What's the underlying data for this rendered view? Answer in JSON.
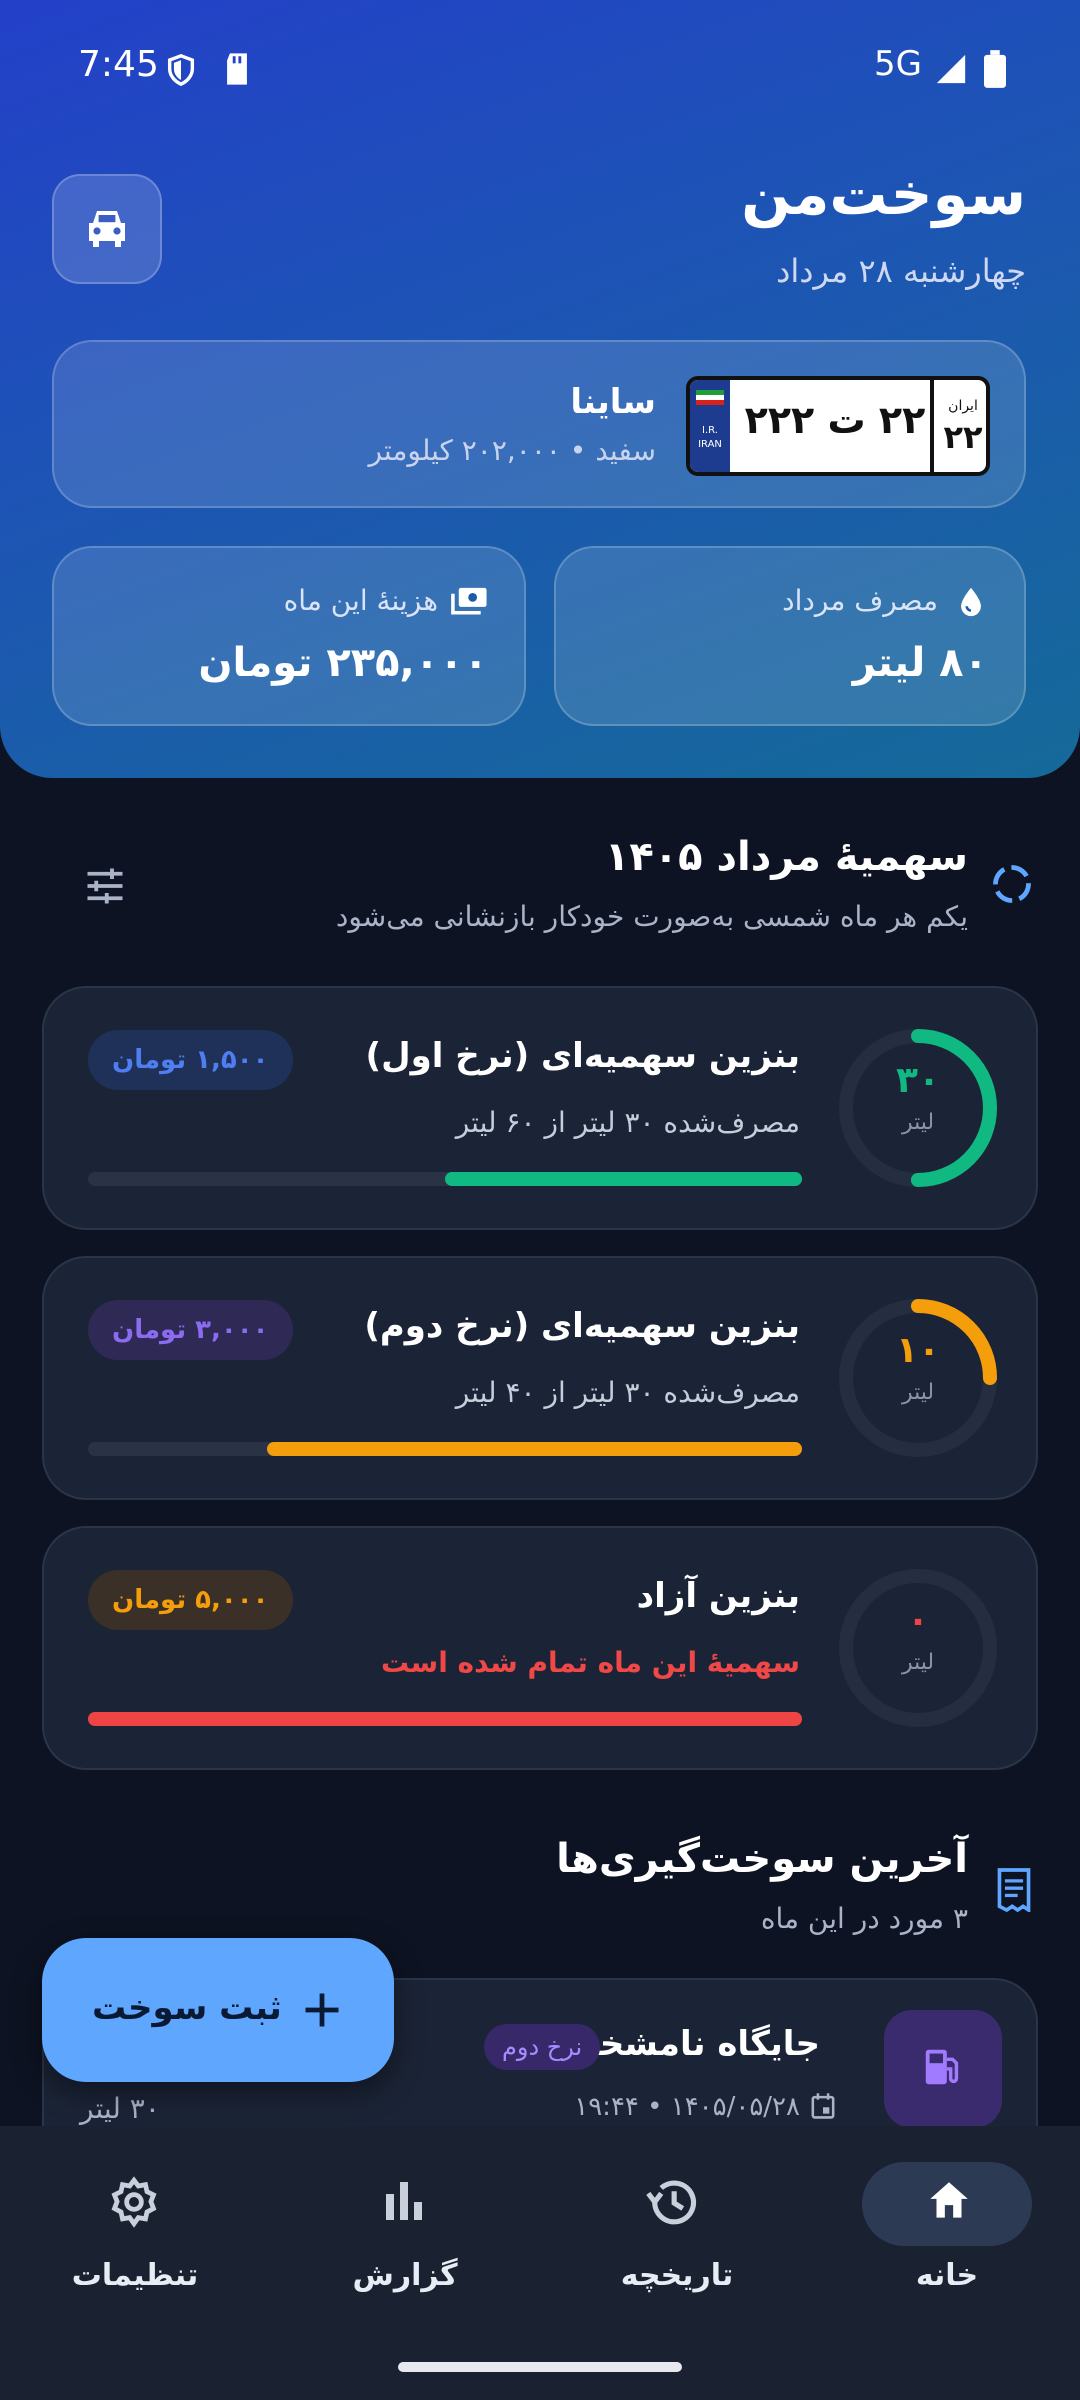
{
  "status_bar": {
    "time": "7:45",
    "network": "5G"
  },
  "header": {
    "app_title": "سوخت‌من",
    "date": "چهارشنبه ۲۸ مرداد"
  },
  "vehicle": {
    "name": "ساینا",
    "details": "سفید • ۲۰۲,۰۰۰ کیلومتر",
    "plate": {
      "number": "۲۲ ت ۲۲۲",
      "region_label": "ایران",
      "region_number": "۲۲",
      "country_text_1": "I.R.",
      "country_text_2": "IRAN"
    }
  },
  "stats": {
    "consumption_label": "مصرف مرداد",
    "consumption_value": "۸۰ لیتر",
    "cost_label": "هزینهٔ این ماه",
    "cost_value": "۲۳۵,۰۰۰ تومان"
  },
  "quota": {
    "title": "سهمیهٔ مرداد ۱۴۰۵",
    "subtitle": "یکم هر ماه شمسی به‌صورت خودکار بازنشانی می‌شود",
    "cards": [
      {
        "name": "بنزین سهمیه‌ای (نرخ اول)",
        "usage": "مصرف‌شده ۳۰ لیتر از ۶۰ لیتر",
        "remaining": "۳۰",
        "unit": "لیتر",
        "price": "۱,۵۰۰ تومان",
        "used_fraction": 0.5,
        "remaining_fraction": 0.5,
        "color": "#10b981",
        "badge_bg": "#1f3158",
        "badge_fg": "#4f7df2"
      },
      {
        "name": "بنزین سهمیه‌ای (نرخ دوم)",
        "usage": "مصرف‌شده ۳۰ لیتر از ۴۰ لیتر",
        "remaining": "۱۰",
        "unit": "لیتر",
        "price": "۳,۰۰۰ تومان",
        "used_fraction": 0.75,
        "remaining_fraction": 0.25,
        "color": "#f59e0b",
        "badge_bg": "#2e2955",
        "badge_fg": "#8b6cf0"
      },
      {
        "name": "بنزین آزاد",
        "usage": "سهمیهٔ این ماه تمام شده است",
        "remaining": "۰",
        "unit": "لیتر",
        "price": "۵,۰۰۰ تومان",
        "used_fraction": 1.0,
        "remaining_fraction": 0,
        "color": "#ef4444",
        "badge_bg": "#3a3028",
        "badge_fg": "#f59e0b"
      }
    ]
  },
  "recent": {
    "title": "آخرین سوخت‌گیری‌ها",
    "subtitle": "۳ مورد در این ماه",
    "entries": [
      {
        "station": "جایگاه نامشخص",
        "tag": "نرخ دوم",
        "datetime": "۱۴۰۵/۰۵/۲۸ • ۱۹:۴۴",
        "liters": "۳۰ لیتر"
      }
    ]
  },
  "fab": {
    "label": "ثبت سوخت"
  },
  "nav": {
    "items": [
      {
        "label": "خانه",
        "icon": "home-icon"
      },
      {
        "label": "تاریخچه",
        "icon": "history-icon"
      },
      {
        "label": "گزارش",
        "icon": "chart-icon"
      },
      {
        "label": "تنظیمات",
        "icon": "gear-icon"
      }
    ]
  }
}
